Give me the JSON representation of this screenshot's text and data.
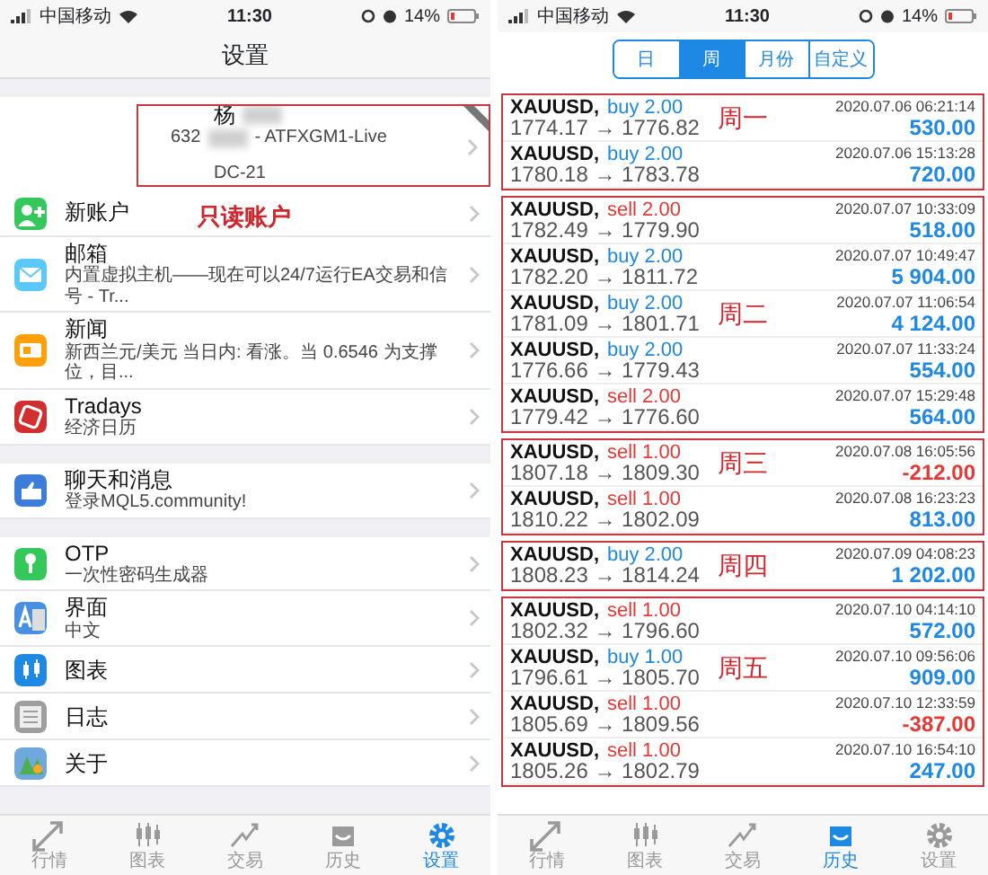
{
  "left_screen": {
    "status_bar": {
      "carrier": "中国移动",
      "time": "11:30",
      "battery": "14%"
    },
    "title": "设置",
    "account": {
      "name": "杨",
      "login": "632",
      "server": "- ATFXGM1-Live",
      "group": "DC-21"
    },
    "annotation": "只读账户",
    "sections": [
      {
        "items": [
          {
            "label": "新账户"
          },
          {
            "label": "邮箱",
            "subtitle": "内置虚拟主机——现在可以24/7运行EA交易和信号 - Tr..."
          },
          {
            "label": "新闻",
            "subtitle": "新西兰元/美元 当日内: 看涨。当 0.6546 为支撑位，目..."
          },
          {
            "label": "Tradays",
            "subtitle": "经济日历"
          }
        ]
      },
      {
        "items": [
          {
            "label": "聊天和消息",
            "subtitle": "登录MQL5.community!"
          }
        ]
      },
      {
        "items": [
          {
            "label": "OTP",
            "subtitle": "一次性密码生成器"
          },
          {
            "label": "界面",
            "subtitle": "中文"
          },
          {
            "label": "图表"
          },
          {
            "label": "日志"
          },
          {
            "label": "关于"
          }
        ]
      }
    ],
    "tab_bar": [
      {
        "label": "行情",
        "selected": false
      },
      {
        "label": "图表",
        "selected": false
      },
      {
        "label": "交易",
        "selected": false
      },
      {
        "label": "历史",
        "selected": false
      },
      {
        "label": "设置",
        "selected": true
      }
    ]
  },
  "right_screen": {
    "status_bar": {
      "carrier": "中国移动",
      "time": "11:30",
      "battery": "14%"
    },
    "segments": [
      {
        "label": "日",
        "selected": false
      },
      {
        "label": "周",
        "selected": true
      },
      {
        "label": "月份",
        "selected": false
      },
      {
        "label": "自定义",
        "selected": false
      }
    ],
    "groups": [
      {
        "label": "周一",
        "trades": [
          {
            "symbol": "XAUUSD,",
            "side": "buy 2.00",
            "kind": "buy",
            "prices": "1774.17 → 1776.82",
            "time": "2020.07.06 06:21:14",
            "profit": "530.00",
            "loss": false
          },
          {
            "symbol": "XAUUSD,",
            "side": "buy 2.00",
            "kind": "buy",
            "prices": "1780.18 → 1783.78",
            "time": "2020.07.06 15:13:28",
            "profit": "720.00",
            "loss": false
          }
        ]
      },
      {
        "label": "周二",
        "trades": [
          {
            "symbol": "XAUUSD,",
            "side": "sell 2.00",
            "kind": "sell",
            "prices": "1782.49 → 1779.90",
            "time": "2020.07.07 10:33:09",
            "profit": "518.00",
            "loss": false
          },
          {
            "symbol": "XAUUSD,",
            "side": "buy 2.00",
            "kind": "buy",
            "prices": "1782.20 → 1811.72",
            "time": "2020.07.07 10:49:47",
            "profit": "5 904.00",
            "loss": false
          },
          {
            "symbol": "XAUUSD,",
            "side": "buy 2.00",
            "kind": "buy",
            "prices": "1781.09 → 1801.71",
            "time": "2020.07.07 11:06:54",
            "profit": "4 124.00",
            "loss": false
          },
          {
            "symbol": "XAUUSD,",
            "side": "buy 2.00",
            "kind": "buy",
            "prices": "1776.66 → 1779.43",
            "time": "2020.07.07 11:33:24",
            "profit": "554.00",
            "loss": false
          },
          {
            "symbol": "XAUUSD,",
            "side": "sell 2.00",
            "kind": "sell",
            "prices": "1779.42 → 1776.60",
            "time": "2020.07.07 15:29:48",
            "profit": "564.00",
            "loss": false
          }
        ]
      },
      {
        "label": "周三",
        "trades": [
          {
            "symbol": "XAUUSD,",
            "side": "sell 1.00",
            "kind": "sell",
            "prices": "1807.18 → 1809.30",
            "time": "2020.07.08 16:05:56",
            "profit": "-212.00",
            "loss": true
          },
          {
            "symbol": "XAUUSD,",
            "side": "sell 1.00",
            "kind": "sell",
            "prices": "1810.22 → 1802.09",
            "time": "2020.07.08 16:23:23",
            "profit": "813.00",
            "loss": false
          }
        ]
      },
      {
        "label": "周四",
        "trades": [
          {
            "symbol": "XAUUSD,",
            "side": "buy 2.00",
            "kind": "buy",
            "prices": "1808.23 → 1814.24",
            "time": "2020.07.09 04:08:23",
            "profit": "1 202.00",
            "loss": false
          }
        ]
      },
      {
        "label": "周五",
        "trades": [
          {
            "symbol": "XAUUSD,",
            "side": "sell 1.00",
            "kind": "sell",
            "prices": "1802.32 → 1796.60",
            "time": "2020.07.10 04:14:10",
            "profit": "572.00",
            "loss": false
          },
          {
            "symbol": "XAUUSD,",
            "side": "buy 1.00",
            "kind": "buy",
            "prices": "1796.61 → 1805.70",
            "time": "2020.07.10 09:56:06",
            "profit": "909.00",
            "loss": false
          },
          {
            "symbol": "XAUUSD,",
            "side": "sell 1.00",
            "kind": "sell",
            "prices": "1805.69 → 1809.56",
            "time": "2020.07.10 12:33:59",
            "profit": "-387.00",
            "loss": true
          },
          {
            "symbol": "XAUUSD,",
            "side": "sell 1.00",
            "kind": "sell",
            "prices": "1805.26 → 1802.79",
            "time": "2020.07.10 16:54:10",
            "profit": "247.00",
            "loss": false
          }
        ]
      }
    ],
    "tab_bar": [
      {
        "label": "行情",
        "selected": false
      },
      {
        "label": "图表",
        "selected": false
      },
      {
        "label": "交易",
        "selected": false
      },
      {
        "label": "历史",
        "selected": true
      },
      {
        "label": "设置",
        "selected": false
      }
    ]
  }
}
